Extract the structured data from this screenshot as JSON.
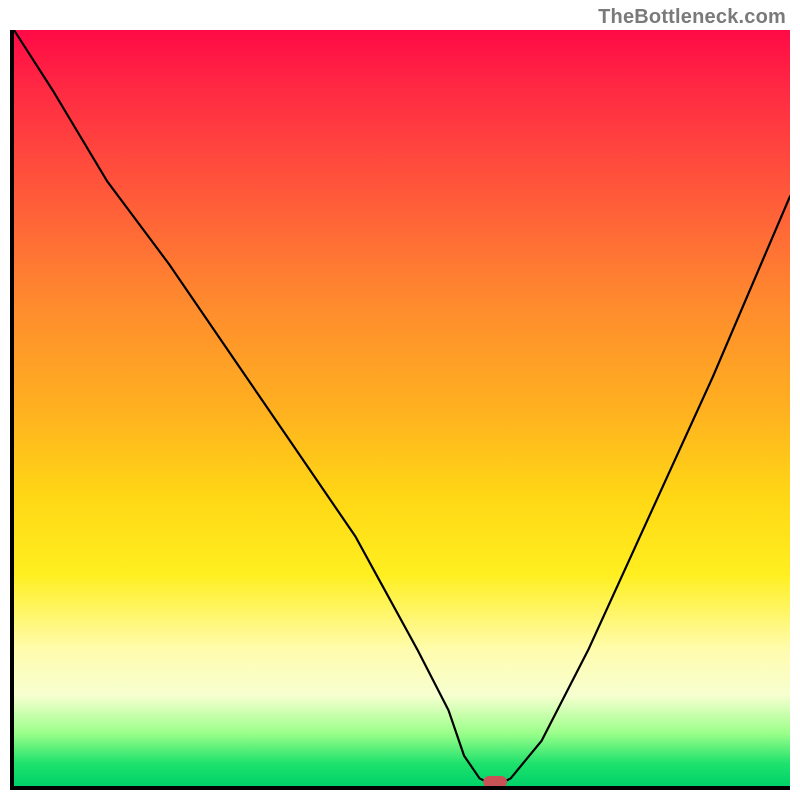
{
  "watermark": "TheBottleneck.com",
  "colors": {
    "axis": "#000000",
    "curve": "#000000",
    "marker": "#c95257",
    "gradient_top": "#ff0a46",
    "gradient_bottom": "#00d26a"
  },
  "chart_data": {
    "type": "line",
    "title": "",
    "xlabel": "",
    "ylabel": "",
    "xlim": [
      0,
      100
    ],
    "ylim": [
      0,
      100
    ],
    "grid": false,
    "legend": false,
    "annotations": [
      "TheBottleneck.com"
    ],
    "series": [
      {
        "name": "bottleneck-curve",
        "x": [
          0,
          5,
          12,
          20,
          28,
          36,
          44,
          52,
          56,
          58,
          60,
          62,
          64,
          68,
          74,
          82,
          90,
          100
        ],
        "y": [
          100,
          92,
          80,
          69,
          57,
          45,
          33,
          18,
          10,
          4,
          1,
          0,
          1,
          6,
          18,
          36,
          54,
          78
        ]
      }
    ],
    "minimum_marker": {
      "x": 62,
      "y": 0,
      "label": ""
    }
  }
}
